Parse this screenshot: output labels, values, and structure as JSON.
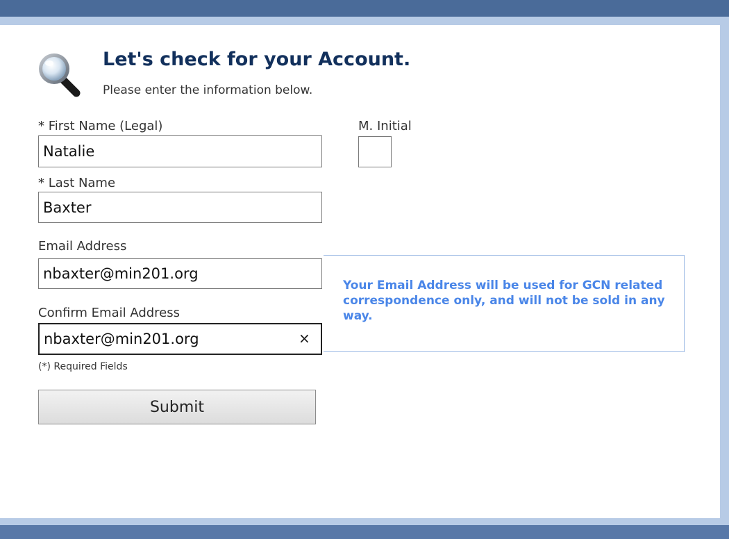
{
  "header": {
    "title": "Let's check for your Account.",
    "subtitle": "Please enter the information below."
  },
  "form": {
    "first_name": {
      "label": "* First Name (Legal)",
      "value": "Natalie"
    },
    "middle_initial": {
      "label": "M. Initial",
      "value": ""
    },
    "last_name": {
      "label": "* Last Name",
      "value": "Baxter"
    },
    "email": {
      "label": "Email Address",
      "value": "nbaxter@min201.org"
    },
    "confirm_email": {
      "label": "Confirm Email Address",
      "value": "nbaxter@min201.org",
      "clear_glyph": "×"
    },
    "required_note": "(*) Required Fields",
    "submit_label": "Submit"
  },
  "info": {
    "text": "Your Email Address will be used for GCN related correspondence only, and will not be sold in any way."
  },
  "icons": {
    "header_icon": "magnifying-glass-icon",
    "clear_icon": "close-icon"
  },
  "colors": {
    "frame_dark": "#4a6b99",
    "frame_light": "#b7cbe6",
    "title": "#12305c",
    "info_text": "#4a86e8",
    "info_border": "#9ab8e4"
  }
}
